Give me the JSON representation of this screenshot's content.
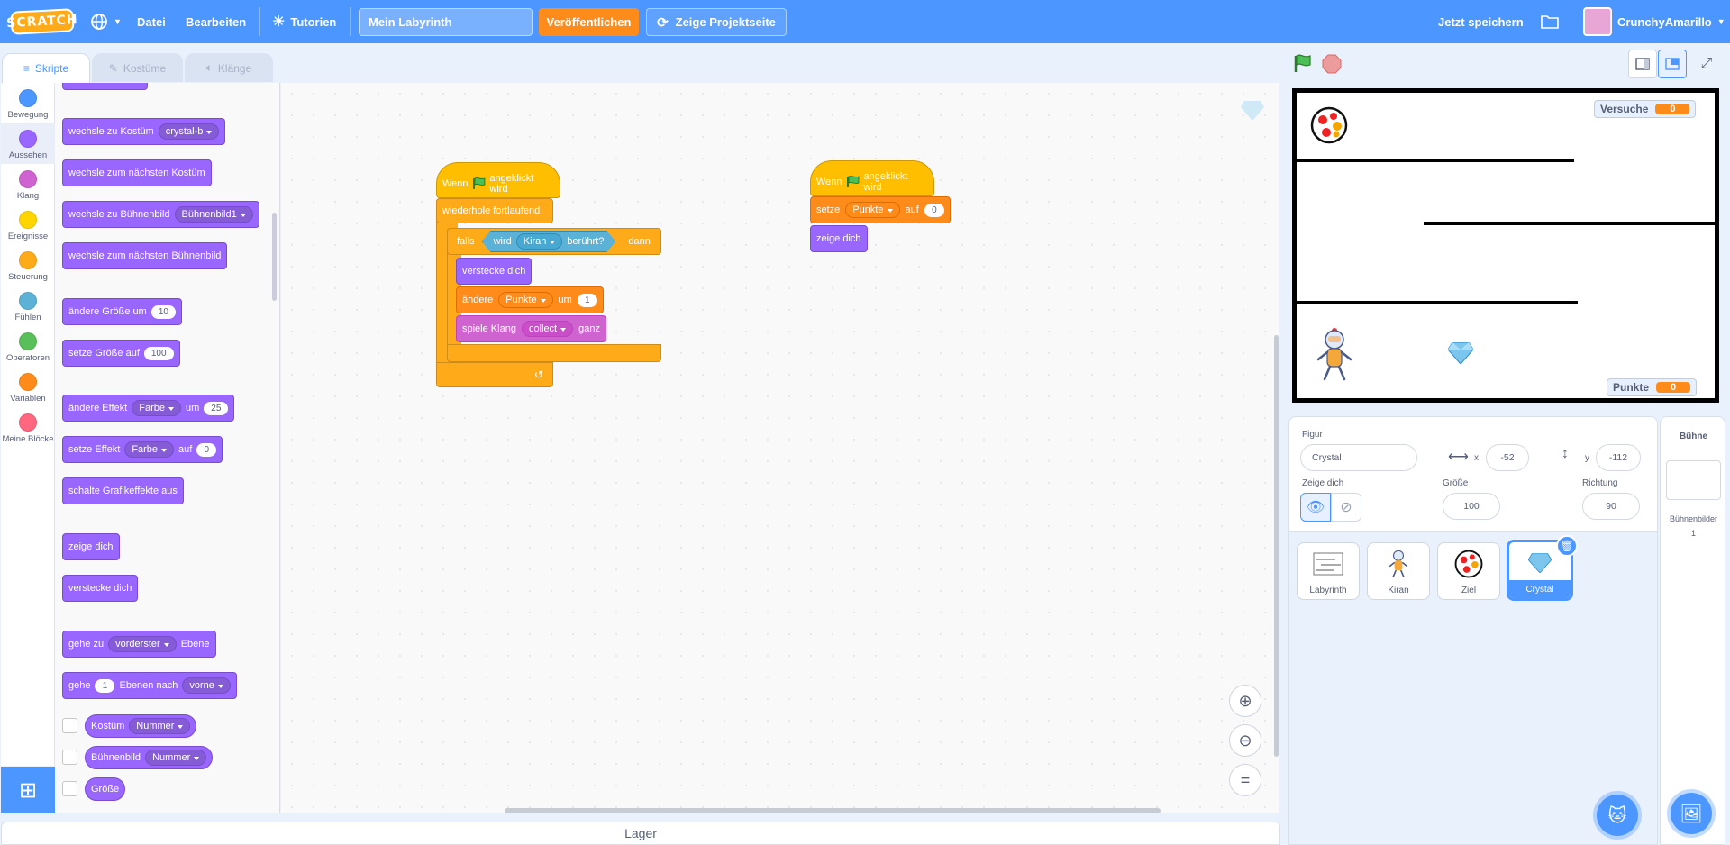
{
  "menubar": {
    "logo": "SCRATCH",
    "file": "Datei",
    "edit": "Bearbeiten",
    "tutorials": "Tutorien",
    "project_title": "Mein Labyrinth",
    "share": "Veröffentlichen",
    "project_page": "Zeige Projektseite",
    "save_now": "Jetzt speichern",
    "username": "CrunchyAmarillo"
  },
  "tabs": [
    "Skripte",
    "Kostüme",
    "Klänge"
  ],
  "categories": [
    {
      "label": "Bewegung",
      "color": "#4c97ff"
    },
    {
      "label": "Aussehen",
      "color": "#9966ff"
    },
    {
      "label": "Klang",
      "color": "#cf63cf"
    },
    {
      "label": "Ereignisse",
      "color": "#ffd500"
    },
    {
      "label": "Steuerung",
      "color": "#ffab19"
    },
    {
      "label": "Fühlen",
      "color": "#5cb1d6"
    },
    {
      "label": "Operatoren",
      "color": "#59c059"
    },
    {
      "label": "Variablen",
      "color": "#ff8c1a"
    },
    {
      "label": "Meine Blöcke",
      "color": "#ff6680"
    }
  ],
  "palette": {
    "switch_costume": "wechsle zu Kostüm",
    "switch_costume_val": "crystal-b",
    "next_costume": "wechsle zum nächsten Kostüm",
    "switch_backdrop": "wechsle zu Bühnenbild",
    "switch_backdrop_val": "Bühnenbild1",
    "next_backdrop": "wechsle zum nächsten Bühnenbild",
    "change_size": "ändere Größe um",
    "change_size_val": "10",
    "set_size": "setze Größe auf",
    "set_size_val": "100",
    "change_effect": "ändere Effekt",
    "change_effect_val": "Farbe",
    "change_effect_by": "um",
    "change_effect_num": "25",
    "set_effect": "setze Effekt",
    "set_effect_val": "Farbe",
    "set_effect_to": "auf",
    "set_effect_num": "0",
    "clear_effects": "schalte Grafikeffekte aus",
    "show": "zeige dich",
    "hide": "verstecke dich",
    "goto_layer": "gehe zu",
    "goto_layer_val": "vorderster",
    "goto_layer_end": "Ebene",
    "go_layers": "gehe",
    "go_layers_num": "1",
    "go_layers_mid": "Ebenen nach",
    "go_layers_val": "vorne",
    "rep_costume": "Kostüm",
    "rep_costume_val": "Nummer",
    "rep_backdrop": "Bühnenbild",
    "rep_backdrop_val": "Nummer",
    "rep_size": "Größe"
  },
  "script1": {
    "hat": "Wenn",
    "hat_end": "angeklickt wird",
    "forever": "wiederhole fortlaufend",
    "if": "falls",
    "then": "dann",
    "touching_pre": "wird",
    "touching_val": "Kiran",
    "touching_post": "berührt?",
    "hide": "verstecke dich",
    "change_var": "ändere",
    "change_var_val": "Punkte",
    "change_by": "um",
    "change_num": "1",
    "play_sound": "spiele Klang",
    "play_sound_val": "collect",
    "play_sound_end": "ganz"
  },
  "script2": {
    "hat": "Wenn",
    "hat_end": "angeklickt wird",
    "set_var": "setze",
    "set_var_val": "Punkte",
    "set_to": "auf",
    "set_num": "0",
    "show": "zeige dich"
  },
  "lager": "Lager",
  "stage": {
    "monitor_tries_label": "Versuche",
    "monitor_tries_value": "0",
    "monitor_points_label": "Punkte",
    "monitor_points_value": "0"
  },
  "sprite_info": {
    "sprite_label": "Figur",
    "sprite_name": "Crystal",
    "x_label": "x",
    "x_value": "-52",
    "y_label": "y",
    "y_value": "-112",
    "show_label": "Zeige dich",
    "size_label": "Größe",
    "size_value": "100",
    "direction_label": "Richtung",
    "direction_value": "90"
  },
  "sprites": [
    "Labyrinth",
    "Kiran",
    "Ziel",
    "Crystal"
  ],
  "stage_panel": {
    "title": "Bühne",
    "backdrops_label": "Bühnenbilder",
    "backdrops_count": "1"
  }
}
